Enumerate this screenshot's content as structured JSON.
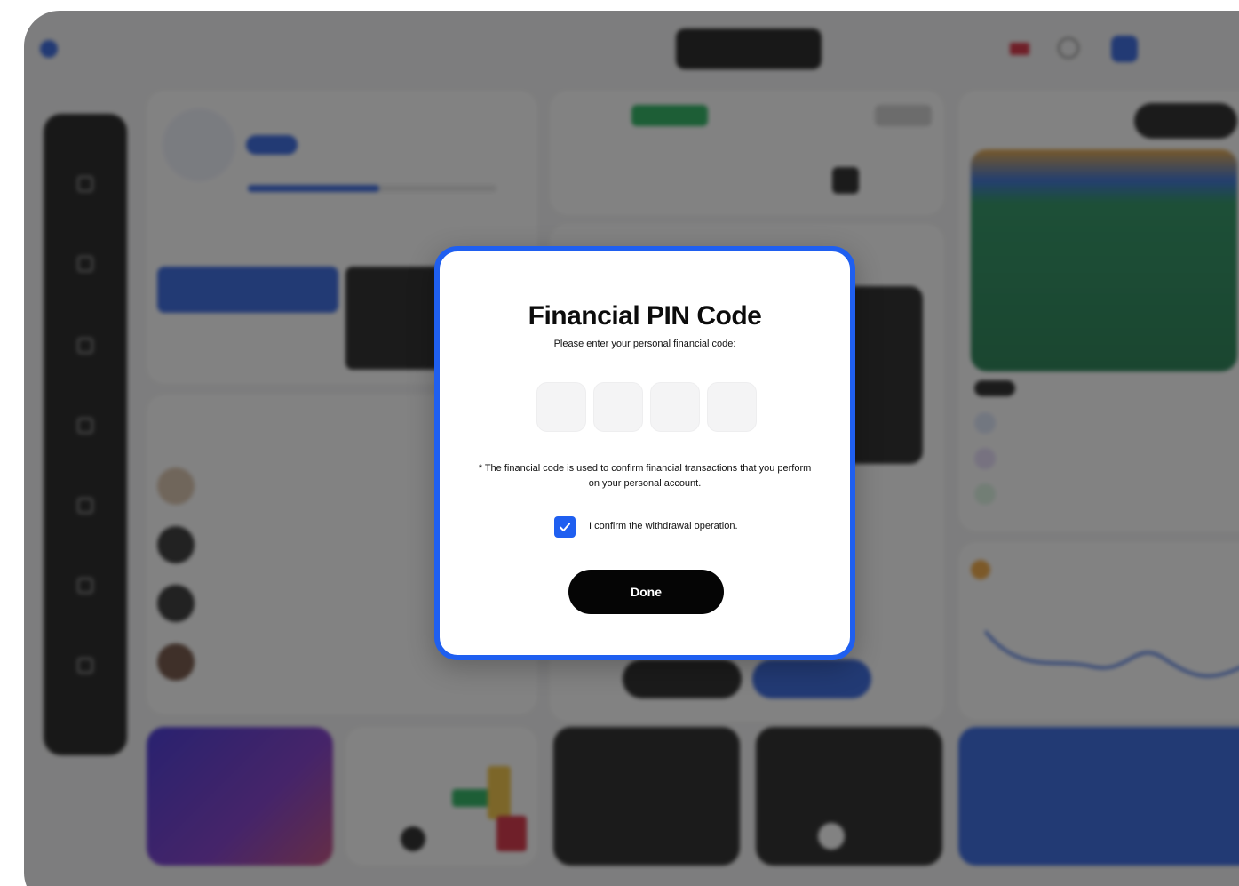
{
  "modal": {
    "title": "Financial PIN Code",
    "subtitle": "Please enter your personal financial code:",
    "pin": {
      "length": 4,
      "digits": [
        "",
        "",
        "",
        ""
      ]
    },
    "note": "* The financial code is used to confirm financial transactions that you perform on your personal account.",
    "confirm": {
      "checked": true,
      "label": "I confirm the withdrawal operation."
    },
    "done_label": "Done"
  },
  "colors": {
    "accent": "#1f5ff0",
    "button": "#050505",
    "overlay": "rgba(28,28,28,0.55)"
  }
}
